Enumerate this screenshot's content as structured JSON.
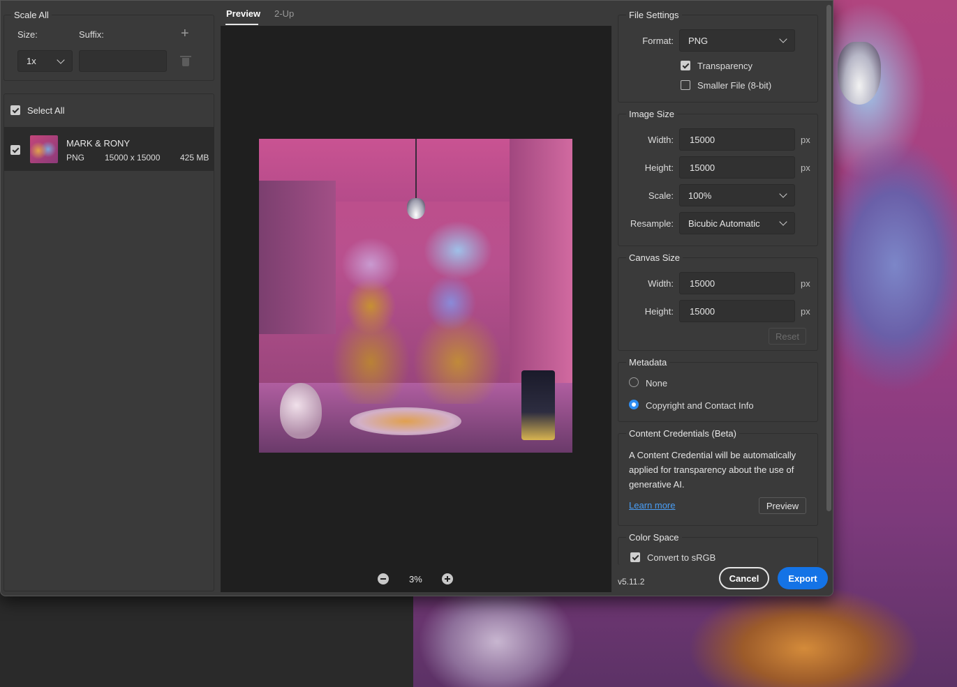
{
  "scale_all": {
    "title": "Scale All",
    "size_label": "Size:",
    "suffix_label": "Suffix:",
    "size_value": "1x",
    "suffix_value": "",
    "add_icon": "plus-icon",
    "delete_icon": "trash-icon"
  },
  "assets": {
    "select_all_label": "Select All",
    "select_all_checked": true,
    "items": [
      {
        "name": "MARK & RONY",
        "format": "PNG",
        "dimensions": "15000 x 15000",
        "size": "425 MB",
        "checked": true
      }
    ]
  },
  "preview": {
    "tabs": [
      {
        "label": "Preview",
        "active": true
      },
      {
        "label": "2-Up",
        "active": false
      }
    ],
    "zoom": "3%"
  },
  "file_settings": {
    "title": "File Settings",
    "format_label": "Format:",
    "format_value": "PNG",
    "transparency_label": "Transparency",
    "transparency_checked": true,
    "smaller_file_label": "Smaller File (8-bit)",
    "smaller_file_checked": false
  },
  "image_size": {
    "title": "Image Size",
    "width_label": "Width:",
    "width_value": "15000",
    "height_label": "Height:",
    "height_value": "15000",
    "scale_label": "Scale:",
    "scale_value": "100%",
    "resample_label": "Resample:",
    "resample_value": "Bicubic Automatic",
    "unit": "px"
  },
  "canvas_size": {
    "title": "Canvas Size",
    "width_label": "Width:",
    "width_value": "15000",
    "height_label": "Height:",
    "height_value": "15000",
    "unit": "px",
    "reset_label": "Reset"
  },
  "metadata": {
    "title": "Metadata",
    "options": [
      {
        "label": "None",
        "selected": false
      },
      {
        "label": "Copyright and Contact Info",
        "selected": true
      }
    ]
  },
  "content_credentials": {
    "title": "Content Credentials (Beta)",
    "description": "A Content Credential will be automatically applied for transparency about the use of generative AI.",
    "learn_more": "Learn more",
    "preview_label": "Preview"
  },
  "color_space": {
    "title": "Color Space",
    "convert_label": "Convert to sRGB",
    "convert_checked": true
  },
  "footer": {
    "version": "v5.11.2",
    "cancel_label": "Cancel",
    "export_label": "Export"
  },
  "colors": {
    "accent": "#1473e6",
    "radio_selected": "#2f8df0",
    "link": "#4a9ef5",
    "dialog_bg": "#3a3a3a",
    "preview_bg": "#1f1f1f"
  }
}
